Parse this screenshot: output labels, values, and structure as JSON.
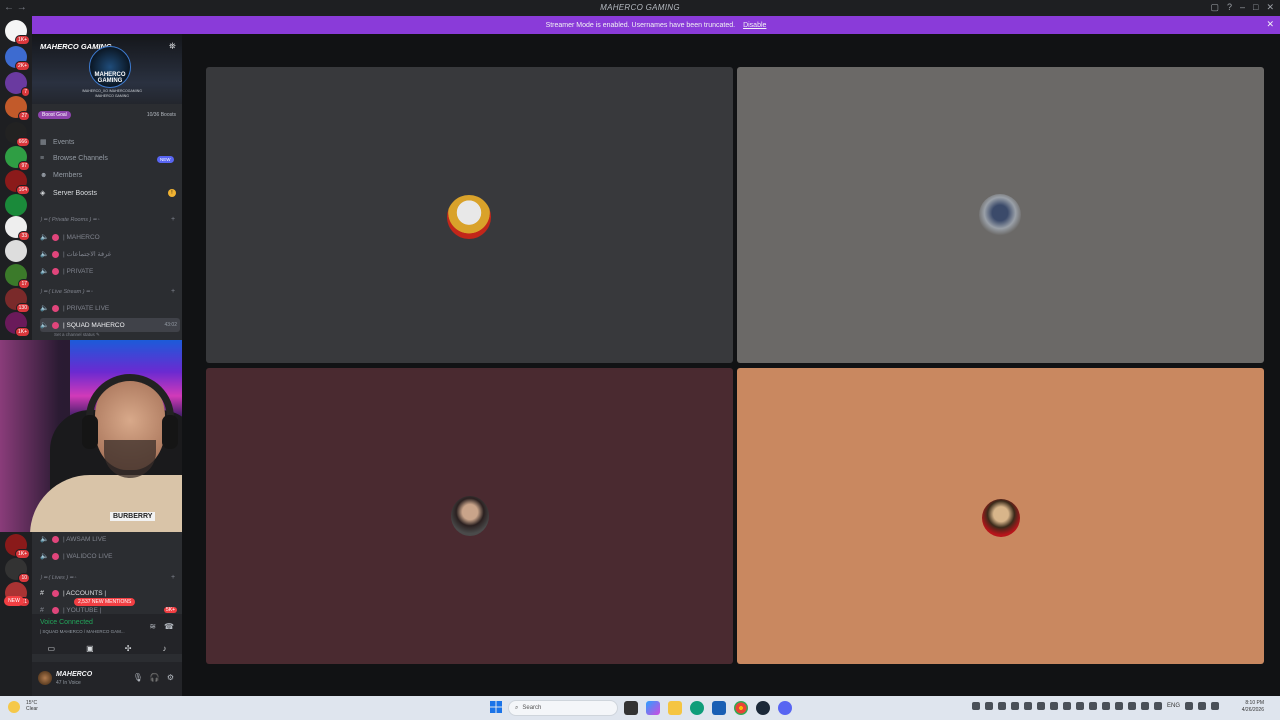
{
  "window": {
    "title": "MAHERCO GAMING",
    "nav": "← →"
  },
  "banner": {
    "text": "Streamer Mode is enabled. Usernames have been truncated.",
    "action": "Disable"
  },
  "server_rail": {
    "badges": [
      "1K+",
      "2K+",
      "7",
      "27",
      "666",
      "97",
      "164",
      "33",
      "17",
      "130",
      "1K+",
      "1K+",
      "10",
      "31",
      "NEW"
    ]
  },
  "server": {
    "name": "MAHERCO GAMING",
    "logo_text": "MAHERCO GAMING",
    "social_1": "/MAHERCO_XO  /MAHERCOGAMING",
    "social_2": "/MAHERCO GAMING",
    "boost_label": "Boost Goal",
    "boost_count": "10/36 Boosts"
  },
  "menu": [
    {
      "label": "Events",
      "icon": "calendar-icon"
    },
    {
      "label": "Browse Channels",
      "icon": "browse-icon",
      "pill": "NEW"
    },
    {
      "label": "Members",
      "icon": "members-icon"
    },
    {
      "label": "Server Boosts",
      "icon": "boost-icon"
    }
  ],
  "categories": {
    "private_rooms": "⟩ ━ ( Private Rooms ) ━ ◦",
    "live_stream": "⟩ ━ ( Live Stream ) ━ ◦",
    "lives": "⟩ ━ ( Lives ) ━ ◦"
  },
  "channels": {
    "c1": "| MAHERCO",
    "c2": "| غرفة الاجتماعات",
    "c3": "| PRIVATE",
    "c4": "| PRIVATE LIVE",
    "c5": "| SQUAD MAHERCO",
    "c5_time": "43:02",
    "c5_status": "Set a channel status ✎",
    "c6": "| AWSAM LIVE",
    "c7": "| WALIDCO LIVE",
    "c8": "| ACCOUNTS |",
    "c9": "| YOUTUBE |",
    "c9_badge": "5K+",
    "mentions": "2,537 NEW MENTIONS"
  },
  "voice": {
    "status": "Voice Connected",
    "channel": "| SQUAD MAHERCO / MAHERCO GAM..."
  },
  "user": {
    "name": "MAHERCO",
    "status": "47 In Voice"
  },
  "webcam": {
    "shirt_text": "BURBERRY"
  },
  "tiles": [
    {
      "id": "tile-1",
      "color": "#38393c"
    },
    {
      "id": "tile-2",
      "color": "#6b6967"
    },
    {
      "id": "tile-3",
      "color": "#4a2a30"
    },
    {
      "id": "tile-4",
      "color": "#c98860"
    }
  ],
  "taskbar": {
    "weather_temp": "15°C",
    "weather_desc": "Clear",
    "search_placeholder": "Search",
    "lang": "ENG",
    "time": "8:10 PM",
    "date": "4/26/2026"
  }
}
